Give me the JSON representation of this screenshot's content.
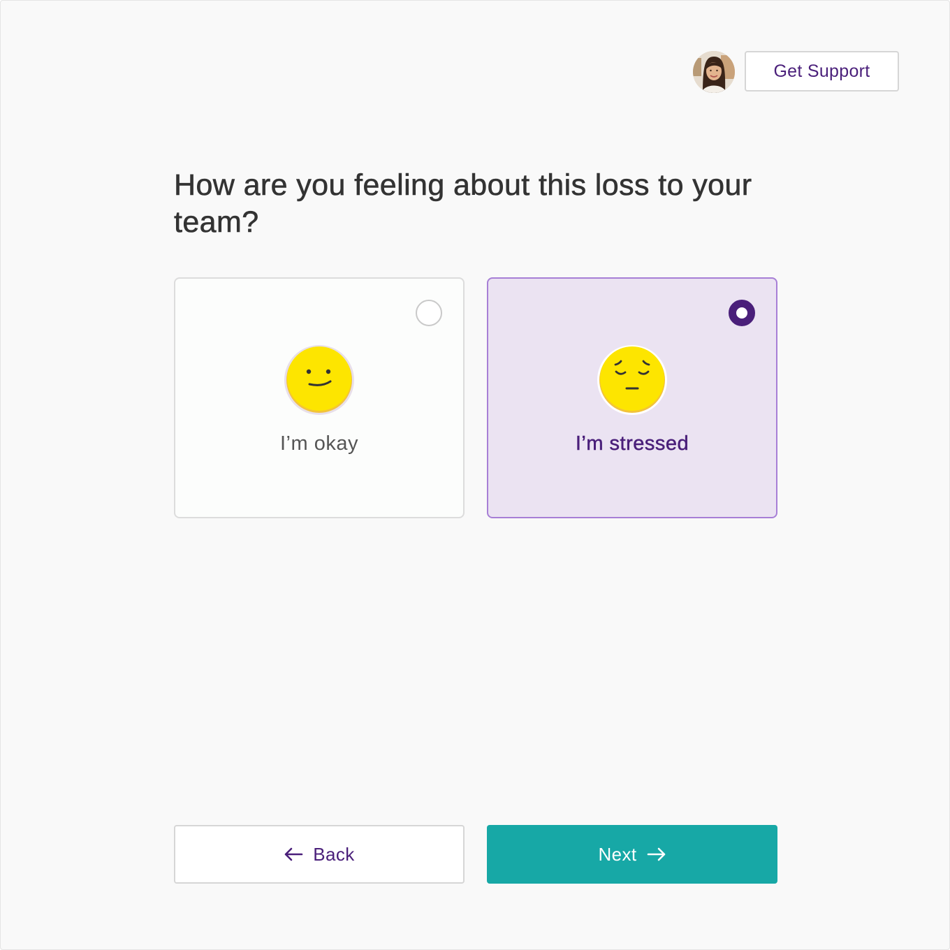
{
  "header": {
    "support_label": "Get Support"
  },
  "question": {
    "text": "How are you feeling about this loss to your team?"
  },
  "options": [
    {
      "label": "I’m okay",
      "icon": "neutral-face-icon",
      "selected": false
    },
    {
      "label": "I’m stressed",
      "icon": "pensive-face-icon",
      "selected": true
    }
  ],
  "navigation": {
    "back_label": "Back",
    "next_label": "Next"
  },
  "colors": {
    "brand_purple": "#4a1f7a",
    "selected_border": "#a77fd6",
    "selected_background": "#ebe3f2",
    "next_button": "#17a8a6",
    "emoji_yellow": "#fde500"
  }
}
